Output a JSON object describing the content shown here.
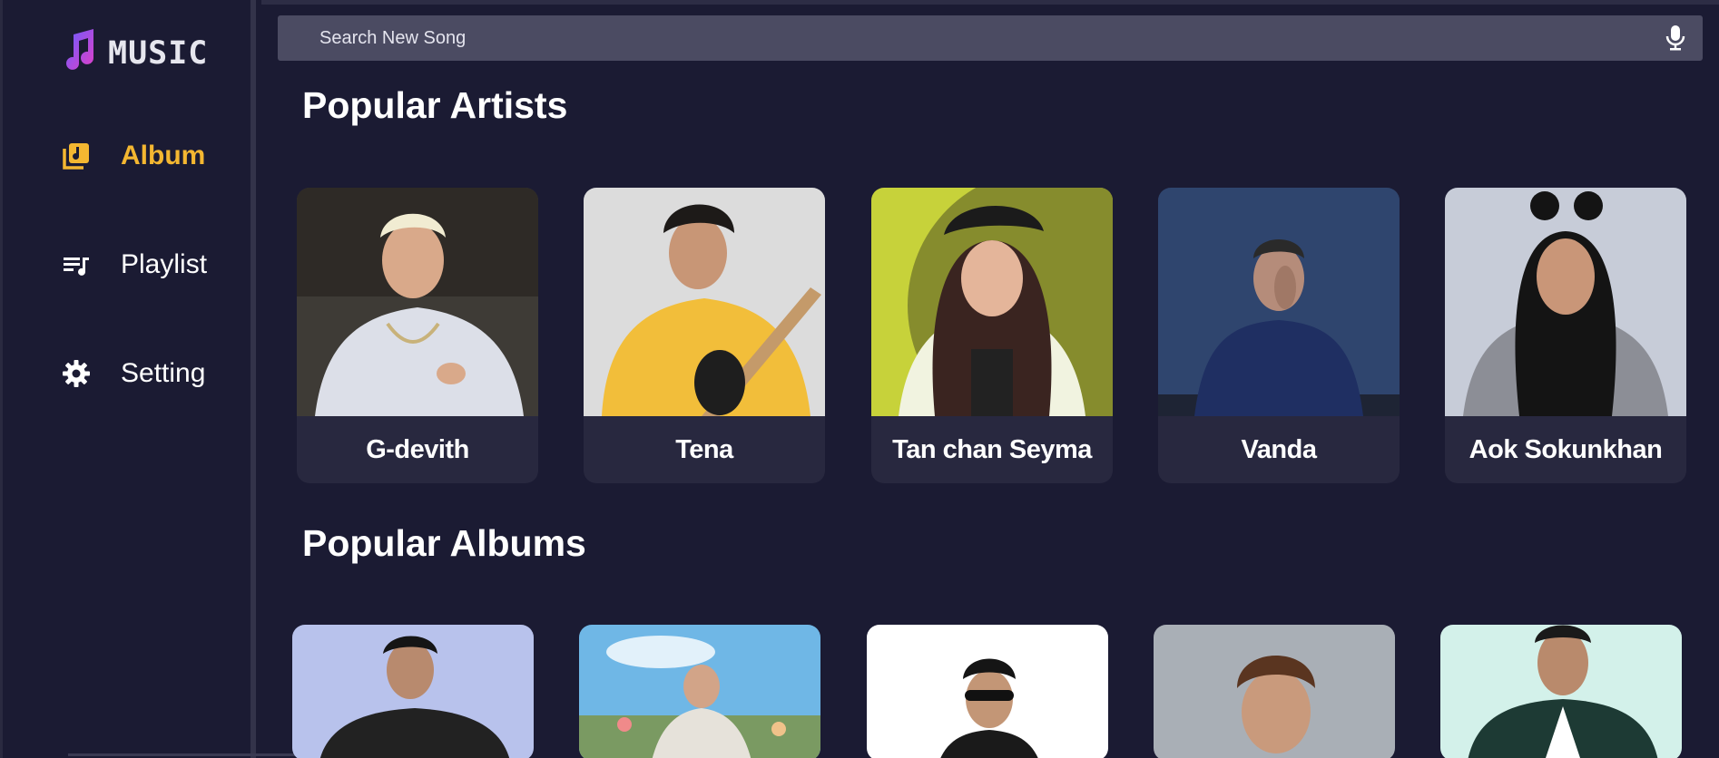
{
  "app": {
    "title": "MUSIC"
  },
  "sidebar": {
    "items": [
      {
        "label": "Album",
        "icon": "album-icon",
        "active": true
      },
      {
        "label": "Playlist",
        "icon": "playlist-icon",
        "active": false
      },
      {
        "label": "Setting",
        "icon": "gear-icon",
        "active": false
      }
    ]
  },
  "search": {
    "placeholder": "Search New Song",
    "icon": "microphone-icon"
  },
  "sections": {
    "artists_title": "Popular Artists",
    "albums_title": "Popular Albums"
  },
  "artists": [
    {
      "name": "G-devith"
    },
    {
      "name": "Tena"
    },
    {
      "name": "Tan chan Seyma"
    },
    {
      "name": "Vanda"
    },
    {
      "name": "Aok Sokunkhan"
    }
  ],
  "colors": {
    "background": "#1b1b33",
    "accent": "#f4b731",
    "card": "#28283f",
    "search": "#4b4b62"
  }
}
